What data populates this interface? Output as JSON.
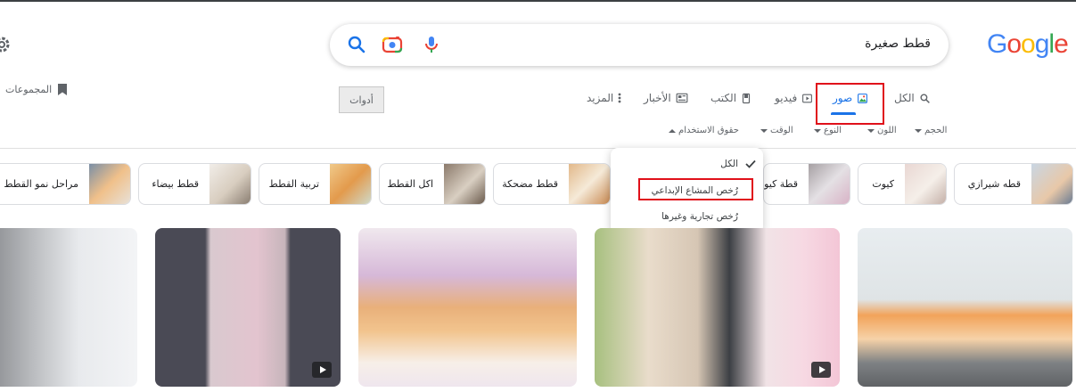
{
  "search": {
    "query": "قطط صغيرة"
  },
  "logo": [
    "G",
    "o",
    "o",
    "g",
    "l",
    "e"
  ],
  "logo_colors": [
    "#4285F4",
    "#EA4335",
    "#FBBC05",
    "#4285F4",
    "#34A853",
    "#EA4335"
  ],
  "tabs": {
    "all": "الكل",
    "images": "صور",
    "videos": "فيديو",
    "books": "الكتب",
    "news": "الأخبار",
    "more": "المزيد"
  },
  "tools_label": "أدوات",
  "collections_label": "المجموعات",
  "filters": {
    "size": "الحجم",
    "color": "اللون",
    "type": "النوع",
    "time": "الوقت",
    "usage_rights": "حقوق الاستخدام"
  },
  "menu": {
    "all": "الكل",
    "creative_commons": "رُخص المشاع الإبداعي",
    "commercial": "رُخص تجارية وغيرها"
  },
  "chips": [
    "قطه شيرازي",
    "كيوت",
    "قطة كيوت",
    "قطط مضحكة",
    "اكل القطط",
    "تربية القطط",
    "قطط بيضاء",
    "مراحل نمو القطط"
  ],
  "accent": "#1a73e8",
  "highlight": "#e0101a"
}
